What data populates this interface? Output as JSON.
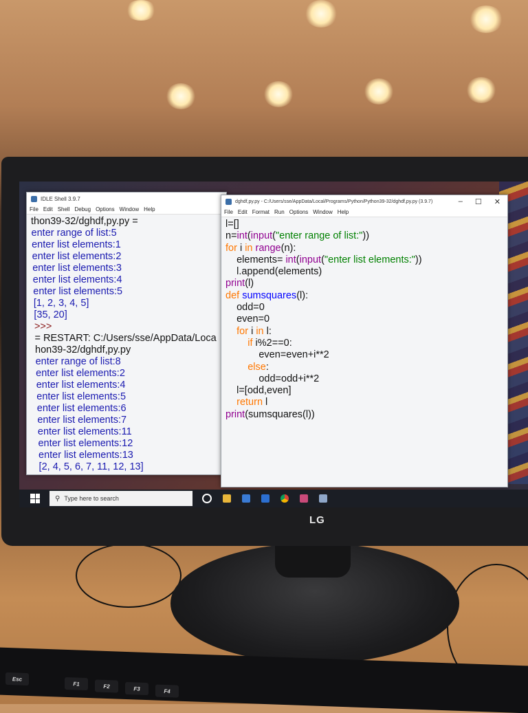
{
  "shell_window": {
    "title": "IDLE Shell 3.9.7",
    "menu": [
      "File",
      "Edit",
      "Shell",
      "Debug",
      "Options",
      "Window",
      "Help"
    ],
    "lines": [
      {
        "text": "thon39-32/dghdf,py.py =",
        "color": "black"
      },
      {
        "text": "enter range of list:5",
        "color": "blue"
      },
      {
        "text": "enter list elements:1",
        "color": "blue"
      },
      {
        "text": "enter list elements:2",
        "color": "blue"
      },
      {
        "text": "enter list elements:3",
        "color": "blue"
      },
      {
        "text": "enter list elements:4",
        "color": "blue"
      },
      {
        "text": "enter list elements:5",
        "color": "blue"
      },
      {
        "text": "[1, 2, 3, 4, 5]",
        "color": "blue"
      },
      {
        "text": "[35, 20]",
        "color": "blue"
      },
      {
        "text": ">>>",
        "color": "prompt"
      },
      {
        "text": "= RESTART: C:/Users/sse/AppData/Loca",
        "color": "black"
      },
      {
        "text": "hon39-32/dghdf,py.py",
        "color": "black"
      },
      {
        "text": "enter range of list:8",
        "color": "blue"
      },
      {
        "text": "enter list elements:2",
        "color": "blue"
      },
      {
        "text": "enter list elements:4",
        "color": "blue"
      },
      {
        "text": "enter list elements:5",
        "color": "blue"
      },
      {
        "text": "enter list elements:6",
        "color": "blue"
      },
      {
        "text": "enter list elements:7",
        "color": "blue"
      },
      {
        "text": "enter list elements:11",
        "color": "blue"
      },
      {
        "text": "enter list elements:12",
        "color": "blue"
      },
      {
        "text": "enter list elements:13",
        "color": "blue"
      },
      {
        "text": "[2, 4, 5, 6, 7, 11, 12, 13]",
        "color": "blue"
      }
    ]
  },
  "editor_window": {
    "title": "dghdf,py.py - C:/Users/sse/AppData/Local/Programs/Python/Python39-32/dghdf,py.py (3.9.7)",
    "menu": [
      "File",
      "Edit",
      "Format",
      "Run",
      "Options",
      "Window",
      "Help"
    ],
    "controls": [
      "–",
      "☐",
      "✕"
    ],
    "code": [
      [
        {
          "t": "l=[]",
          "c": ""
        }
      ],
      [
        {
          "t": "n=",
          "c": ""
        },
        {
          "t": "int",
          "c": "bi"
        },
        {
          "t": "(",
          "c": ""
        },
        {
          "t": "input",
          "c": "bi"
        },
        {
          "t": "(",
          "c": ""
        },
        {
          "t": "\"enter range of list:\"",
          "c": "str"
        },
        {
          "t": "))",
          "c": ""
        }
      ],
      [
        {
          "t": "for",
          "c": "kw"
        },
        {
          "t": " i ",
          "c": ""
        },
        {
          "t": "in",
          "c": "kw"
        },
        {
          "t": " ",
          "c": ""
        },
        {
          "t": "range",
          "c": "bi"
        },
        {
          "t": "(n):",
          "c": ""
        }
      ],
      [
        {
          "t": "    elements= ",
          "c": ""
        },
        {
          "t": "int",
          "c": "bi"
        },
        {
          "t": "(",
          "c": ""
        },
        {
          "t": "input",
          "c": "bi"
        },
        {
          "t": "(",
          "c": ""
        },
        {
          "t": "\"enter list elements:\"",
          "c": "str"
        },
        {
          "t": "))",
          "c": ""
        }
      ],
      [
        {
          "t": "    l.append(elements)",
          "c": ""
        }
      ],
      [
        {
          "t": "print",
          "c": "bi"
        },
        {
          "t": "(l)",
          "c": ""
        }
      ],
      [
        {
          "t": "def",
          "c": "kw"
        },
        {
          "t": " ",
          "c": ""
        },
        {
          "t": "sumsquares",
          "c": "fn"
        },
        {
          "t": "(l):",
          "c": ""
        }
      ],
      [
        {
          "t": "    odd=0",
          "c": ""
        }
      ],
      [
        {
          "t": "    even=0",
          "c": ""
        }
      ],
      [
        {
          "t": "    ",
          "c": ""
        },
        {
          "t": "for",
          "c": "kw"
        },
        {
          "t": " i ",
          "c": ""
        },
        {
          "t": "in",
          "c": "kw"
        },
        {
          "t": " l:",
          "c": ""
        }
      ],
      [
        {
          "t": "        ",
          "c": ""
        },
        {
          "t": "if",
          "c": "kw"
        },
        {
          "t": " i%2==0:",
          "c": ""
        }
      ],
      [
        {
          "t": "            even=even+i**2",
          "c": ""
        }
      ],
      [
        {
          "t": "        ",
          "c": ""
        },
        {
          "t": "else",
          "c": "kw"
        },
        {
          "t": ":",
          "c": ""
        }
      ],
      [
        {
          "t": "            odd=odd+i**2",
          "c": ""
        }
      ],
      [
        {
          "t": "    l=[odd,even]",
          "c": ""
        }
      ],
      [
        {
          "t": "    ",
          "c": ""
        },
        {
          "t": "return",
          "c": "kw"
        },
        {
          "t": " l",
          "c": ""
        }
      ],
      [
        {
          "t": "print",
          "c": "bi"
        },
        {
          "t": "(sumsquares(l))",
          "c": ""
        }
      ]
    ]
  },
  "taskbar": {
    "search_placeholder": "Type here to search"
  },
  "monitor": {
    "brand": "LG"
  },
  "keyboard": {
    "keys": [
      "Esc",
      "F1",
      "F2",
      "F3",
      "F4"
    ]
  }
}
